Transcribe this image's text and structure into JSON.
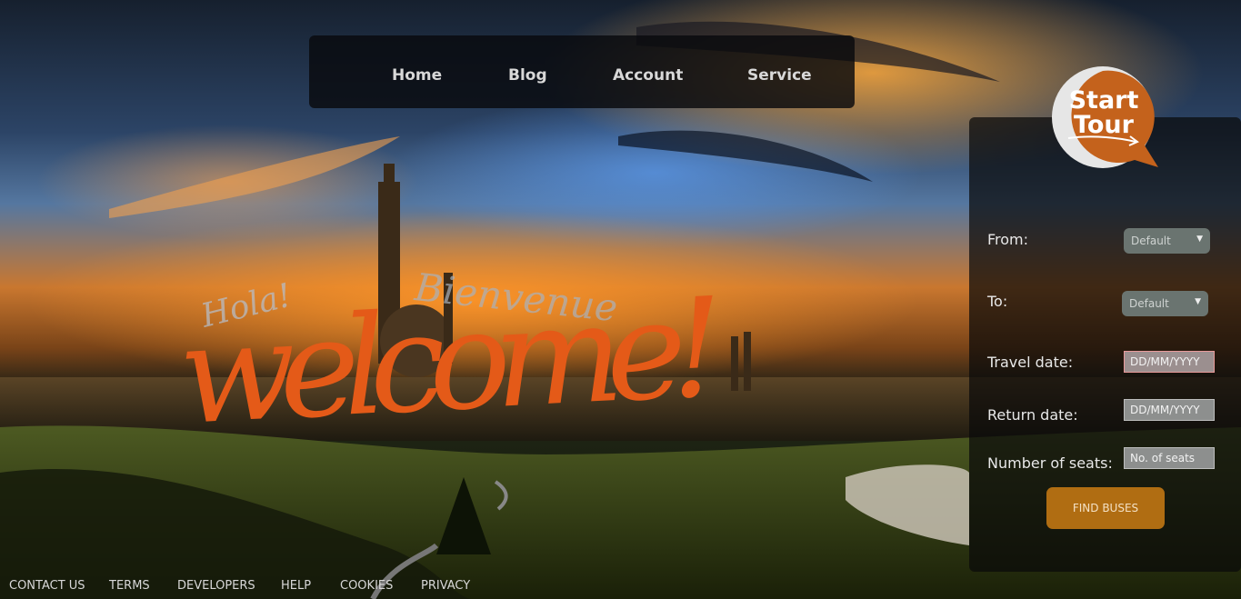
{
  "nav": {
    "items": [
      {
        "label": "Home"
      },
      {
        "label": "Blog"
      },
      {
        "label": "Account"
      },
      {
        "label": "Service"
      }
    ]
  },
  "hero": {
    "greetings": [
      "Hola!",
      "Bienvenue"
    ],
    "headline": "welcome!"
  },
  "booking": {
    "badge": {
      "line1": "Start",
      "line2": "Tour"
    },
    "from": {
      "label": "From:",
      "value": "Default"
    },
    "to": {
      "label": "To:",
      "value": "Default"
    },
    "travel_date": {
      "label": "Travel date:",
      "placeholder": "DD/MM/YYYY"
    },
    "return_date": {
      "label": "Return date:",
      "placeholder": "DD/MM/YYYY"
    },
    "seats": {
      "label": "Number of seats:",
      "placeholder": "No. of seats"
    },
    "submit_label": "FIND BUSES",
    "accent_color": "#b06d12"
  },
  "footer": {
    "links": [
      "CONTACT US",
      "TERMS",
      "DEVELOPERS",
      "HELP",
      "COOKIES",
      "PRIVACY"
    ]
  }
}
